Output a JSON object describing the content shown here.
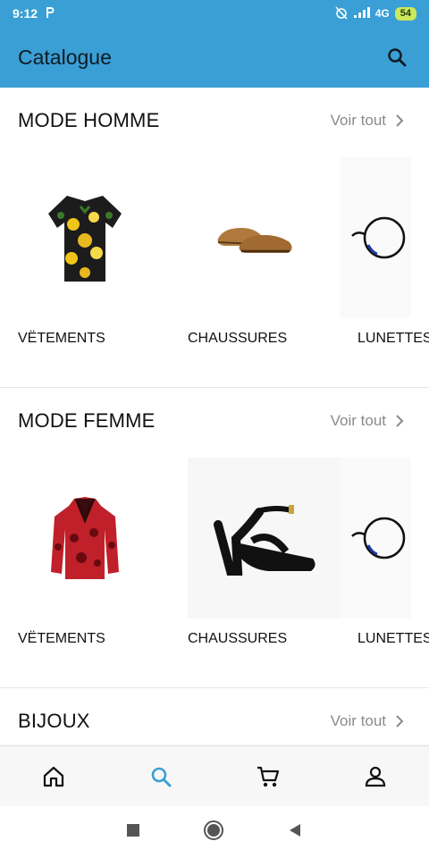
{
  "status": {
    "time": "9:12",
    "carrier_icon": "p-icon",
    "network": "4G",
    "battery": "54"
  },
  "app_bar": {
    "title": "Catalogue"
  },
  "sections": [
    {
      "title": "MODE HOMME",
      "see_all": "Voir tout",
      "items": [
        {
          "label": "VËTEMENTS",
          "image": "shirt"
        },
        {
          "label": "CHAUSSURES",
          "image": "shoes"
        },
        {
          "label": "LUNETTES",
          "image": "glasses"
        }
      ]
    },
    {
      "title": "MODE FEMME",
      "see_all": "Voir tout",
      "items": [
        {
          "label": "VËTEMENTS",
          "image": "jacket"
        },
        {
          "label": "CHAUSSURES",
          "image": "sandal"
        },
        {
          "label": "LUNETTES",
          "image": "glasses"
        }
      ]
    },
    {
      "title": "BIJOUX",
      "see_all": "Voir tout"
    }
  ],
  "bottom_nav": [
    "home-icon",
    "search-icon",
    "cart-icon",
    "profile-icon"
  ],
  "colors": {
    "primary": "#3a9fd4",
    "active_nav": "#3a9fd4"
  }
}
